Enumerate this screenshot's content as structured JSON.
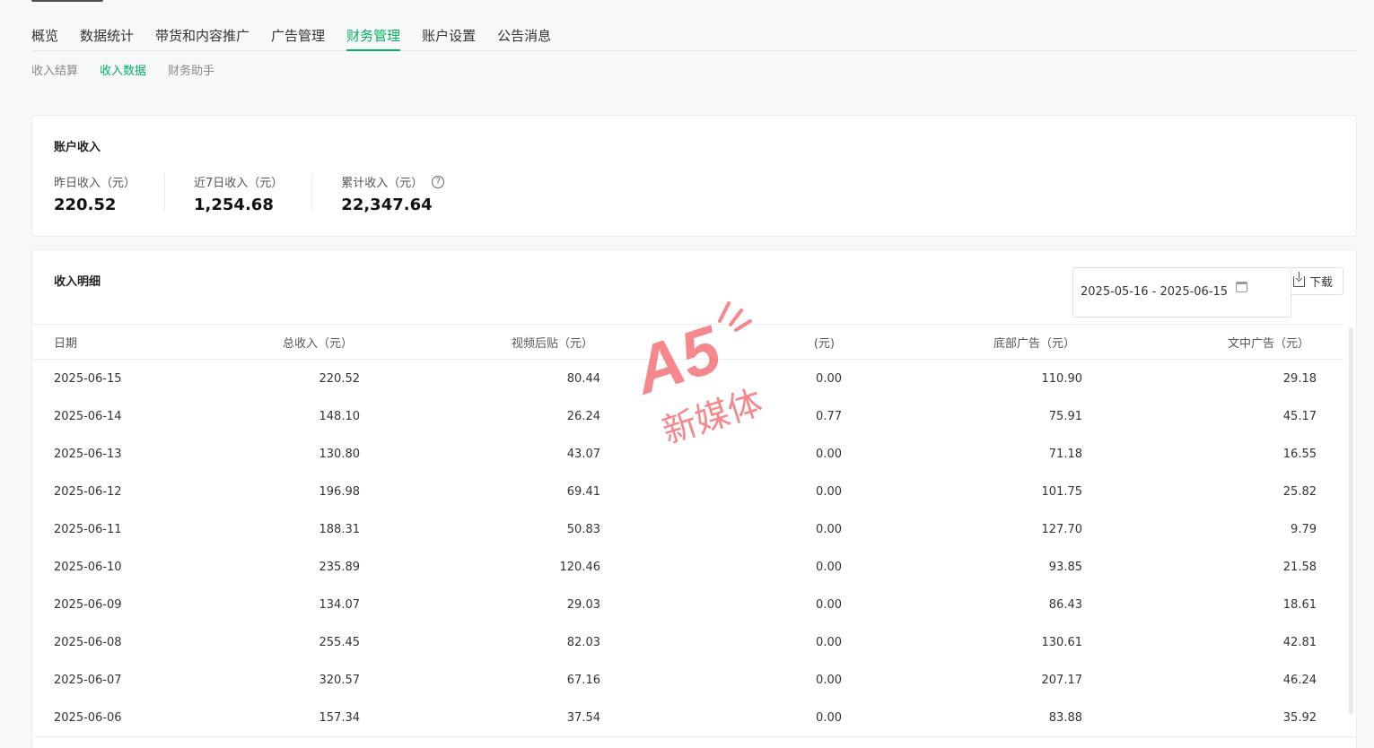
{
  "nav": {
    "tabs": [
      {
        "label": "概览"
      },
      {
        "label": "数据统计"
      },
      {
        "label": "带货和内容推广"
      },
      {
        "label": "广告管理"
      },
      {
        "label": "财务管理",
        "active": true
      },
      {
        "label": "账户设置"
      },
      {
        "label": "公告消息"
      }
    ]
  },
  "subnav": {
    "items": [
      {
        "label": "收入结算"
      },
      {
        "label": "收入数据",
        "active": true
      },
      {
        "label": "财务助手"
      }
    ]
  },
  "summary": {
    "title": "账户收入",
    "stats": [
      {
        "label": "昨日收入（元）",
        "value": "220.52"
      },
      {
        "label": "近7日收入（元）",
        "value": "1,254.68"
      },
      {
        "label": "累计收入（元）",
        "value": "22,347.64",
        "help_icon": "question-icon"
      }
    ]
  },
  "detail": {
    "title": "收入明细",
    "date_range": "2025-05-16 - 2025-06-15",
    "download_label": "下载",
    "columns": [
      "日期",
      "总收入（元）",
      "视频后贴（元）",
      "(元)",
      "底部广告（元）",
      "文中广告（元）"
    ],
    "rows": [
      [
        "2025-06-15",
        "220.52",
        "80.44",
        "0.00",
        "110.90",
        "29.18"
      ],
      [
        "2025-06-14",
        "148.10",
        "26.24",
        "0.77",
        "75.91",
        "45.17"
      ],
      [
        "2025-06-13",
        "130.80",
        "43.07",
        "0.00",
        "71.18",
        "16.55"
      ],
      [
        "2025-06-12",
        "196.98",
        "69.41",
        "0.00",
        "101.75",
        "25.82"
      ],
      [
        "2025-06-11",
        "188.31",
        "50.83",
        "0.00",
        "127.70",
        "9.79"
      ],
      [
        "2025-06-10",
        "235.89",
        "120.46",
        "0.00",
        "93.85",
        "21.58"
      ],
      [
        "2025-06-09",
        "134.07",
        "29.03",
        "0.00",
        "86.43",
        "18.61"
      ],
      [
        "2025-06-08",
        "255.45",
        "82.03",
        "0.00",
        "130.61",
        "42.81"
      ],
      [
        "2025-06-07",
        "320.57",
        "67.16",
        "0.00",
        "207.17",
        "46.24"
      ],
      [
        "2025-06-06",
        "157.34",
        "37.54",
        "0.00",
        "83.88",
        "35.92"
      ]
    ]
  },
  "watermark": {
    "logo_text": "A5",
    "text": "新媒体",
    "color": "#f2545b"
  },
  "colors": {
    "accent": "#07b05f"
  }
}
